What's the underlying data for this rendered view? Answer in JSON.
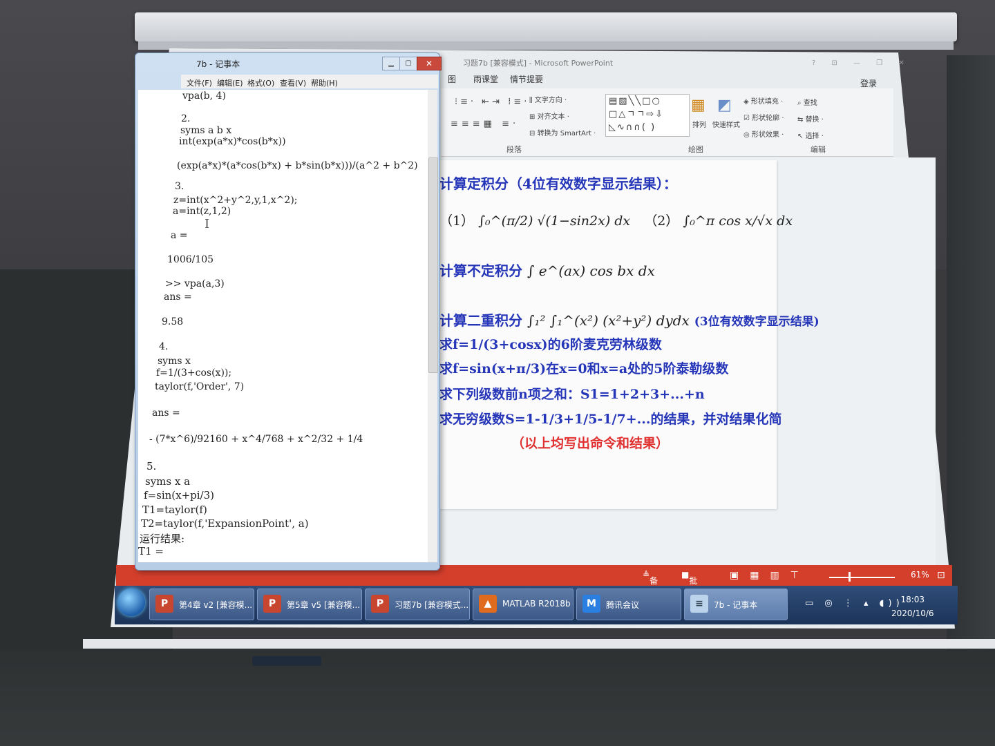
{
  "powerpoint": {
    "title": "习题7b [兼容模式] - Microsoft PowerPoint",
    "tabs": [
      "图",
      "雨课堂",
      "情节提要"
    ],
    "login": "登录",
    "ribbon": {
      "text_direction": "文字方向",
      "align_text": "对齐文本",
      "convert_smartart": "转换为 SmartArt",
      "paragraph_label": "段落",
      "arrange": "排列",
      "quick_styles": "快速样式",
      "shape_fill": "形状填充",
      "shape_outline": "形状轮廓",
      "shape_effects": "形状效果",
      "drawing_label": "绘图",
      "find": "查找",
      "replace": "替换",
      "select": "选择",
      "editing_label": "编辑"
    },
    "slide": {
      "line1": "计算定积分（4位有效数字显示结果）：",
      "item1_label": "（1）",
      "item1_expr": "∫₀^(π/2) √(1−sin2x) dx",
      "item2_label": "（2）",
      "item2_expr": "∫₀^π cos x/√x dx",
      "line2": "计算不定积分",
      "line2_expr": "∫ e^(ax) cos bx dx",
      "line3": "计算二重积分",
      "line3_expr": "∫₁² ∫₁^(x²) (x²+y²) dydx",
      "line3_note": "(3位有效数字显示结果)",
      "line4": "求f=1/(3+cosx)的6阶麦克劳林级数",
      "line5": "求f=sin(x+π/3)在x=0和x=a处的5阶泰勒级数",
      "line6": "求下列级数前n项之和：S1=1+2+3+...+n",
      "line7": "求无穷级数S=1-1/3+1/5-1/7+...的结果，并对结果化简",
      "line8": "（以上均写出命令和结果）"
    },
    "status": {
      "notes": "备注",
      "comments": "批注",
      "zoom": "61%"
    }
  },
  "notepad": {
    "title": "7b - 记事本",
    "menu": [
      "文件(F)",
      "编辑(E)",
      "格式(O)",
      "查看(V)",
      "帮助(H)"
    ],
    "lines": [
      "vpa(b, 4)",
      "2.",
      "syms a b x",
      "int(exp(a*x)*cos(b*x))",
      "(exp(a*x)*(a*cos(b*x) + b*sin(b*x)))/(a^2 + b^2)",
      "3.",
      "z=int(x^2+y^2,y,1,x^2);",
      "a=int(z,1,2)",
      "a =",
      "1006/105",
      ">> vpa(a,3)",
      "ans =",
      "9.58",
      "4.",
      "syms x",
      "f=1/(3+cos(x));",
      "taylor(f,'Order', 7)",
      "ans =",
      "- (7*x^6)/92160 + x^4/768 + x^2/32 + 1/4",
      "5.",
      "syms x a",
      "f=sin(x+pi/3)",
      "T1=taylor(f)",
      "T2=taylor(f,'ExpansionPoint', a)",
      "运行结果:",
      "T1 ="
    ]
  },
  "taskbar": {
    "items": [
      "第4章 v2 [兼容模...",
      "第5章 v5 [兼容模...",
      "习题7b [兼容模式...",
      "MATLAB R2018b",
      "腾讯会议",
      "7b - 记事本"
    ],
    "time": "18:03",
    "date": "2020/10/6"
  }
}
